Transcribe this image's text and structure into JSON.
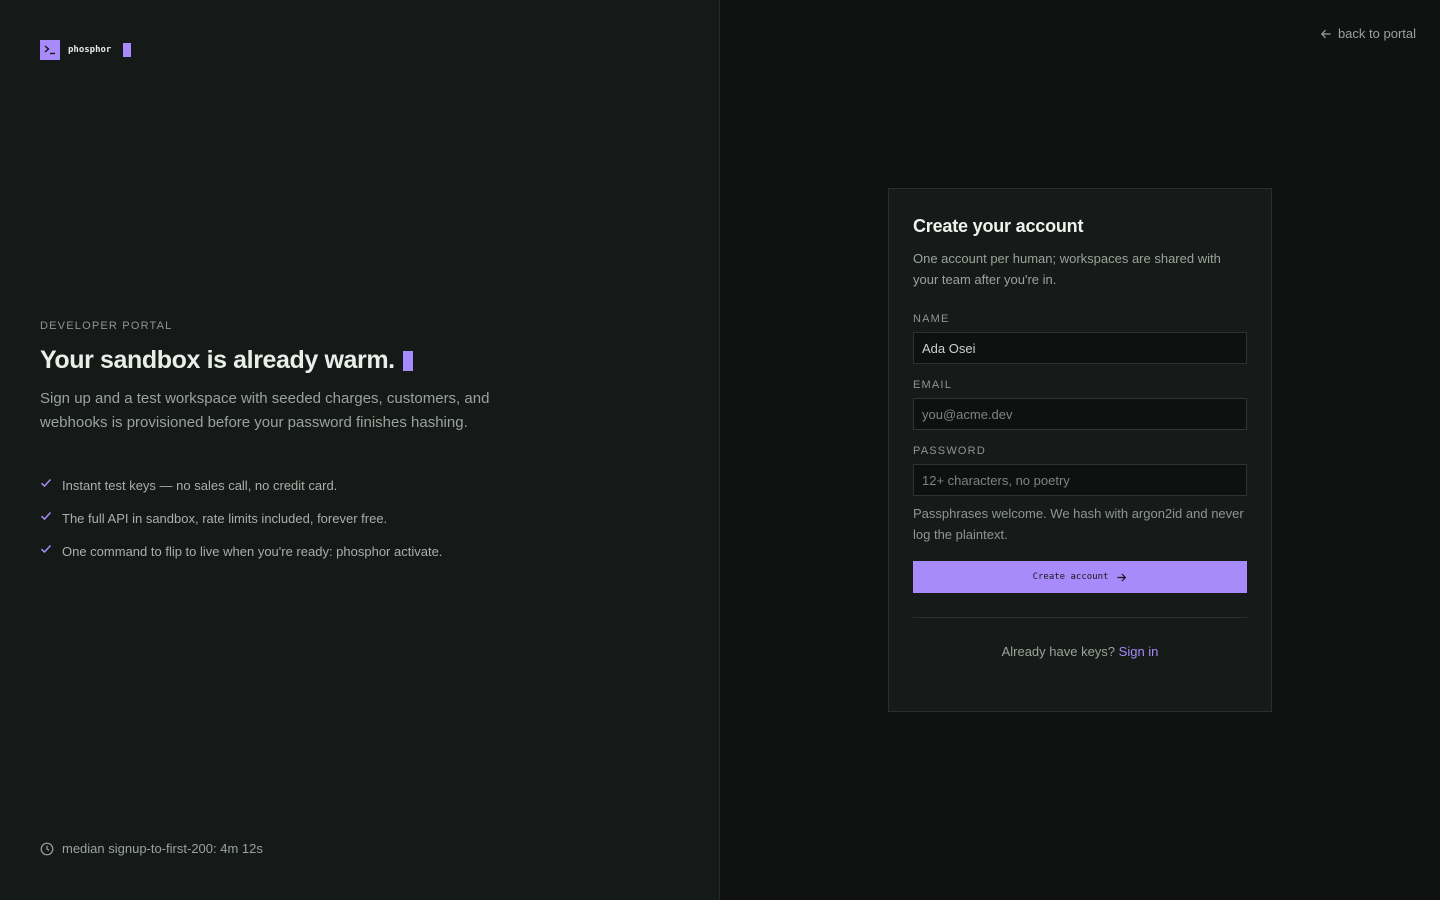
{
  "brand": {
    "name": "phosphor",
    "logo_icon": "terminal-prompt-icon",
    "accent_color": "#a78bfa"
  },
  "hero": {
    "eyebrow": "DEVELOPER PORTAL",
    "title": "Your sandbox is already warm.",
    "subtitle": "Sign up and a test workspace with seeded charges, customers, and webhooks is provisioned before your password finishes hashing.",
    "features": [
      "Instant test keys — no sales call, no credit card.",
      "The full API in sandbox, rate limits included, forever free.",
      "One command to flip to live when you're ready: phosphor activate."
    ]
  },
  "metric": {
    "icon": "clock-icon",
    "text": "median signup-to-first-200: 4m 12s"
  },
  "nav": {
    "back_label": "back to portal",
    "back_icon": "arrow-left-icon"
  },
  "form": {
    "title": "Create your account",
    "subtitle": "One account per human; workspaces are shared with your team after you're in.",
    "name": {
      "label": "NAME",
      "value": "Ada Osei",
      "placeholder": ""
    },
    "email": {
      "label": "EMAIL",
      "value": "",
      "placeholder": "you@acme.dev"
    },
    "password": {
      "label": "PASSWORD",
      "value": "",
      "placeholder": "12+ characters, no poetry"
    },
    "password_hint": "Passphrases welcome. We hash with argon2id and never log the plaintext.",
    "submit_label": "Create account",
    "signin_prompt": "Already have keys?",
    "signin_link": "Sign in"
  }
}
